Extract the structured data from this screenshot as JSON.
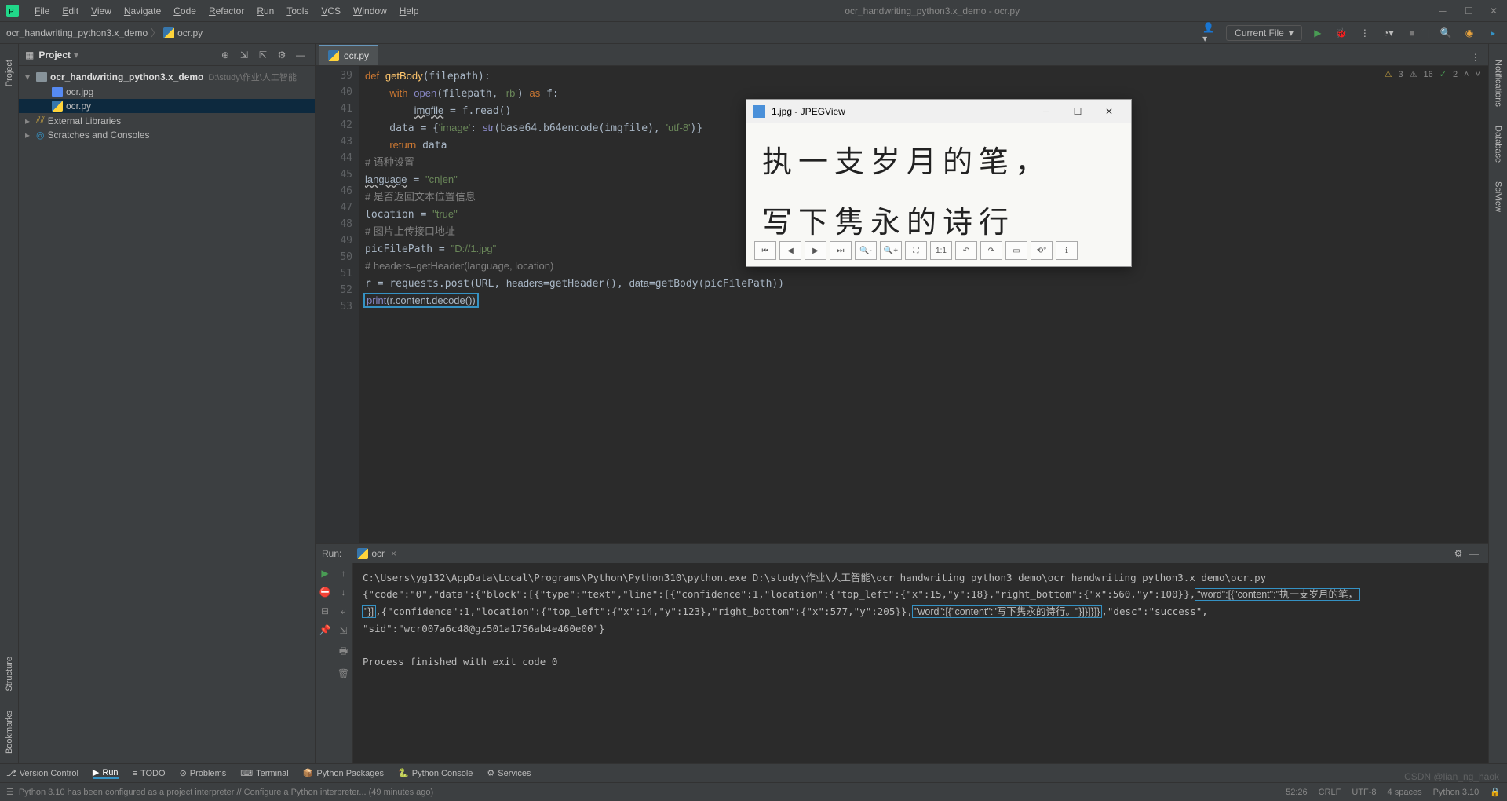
{
  "titlebar": {
    "menus": [
      "File",
      "Edit",
      "View",
      "Navigate",
      "Code",
      "Refactor",
      "Run",
      "Tools",
      "VCS",
      "Window",
      "Help"
    ],
    "center_title": "ocr_handwriting_python3.x_demo - ocr.py"
  },
  "breadcrumb": {
    "project": "ocr_handwriting_python3.x_demo",
    "file": "ocr.py"
  },
  "toolbar": {
    "run_config": "Current File"
  },
  "project_panel": {
    "title": "Project",
    "root": "ocr_handwriting_python3.x_demo",
    "root_path": "D:\\study\\作业\\人工智能",
    "children": [
      "ocr.jpg",
      "ocr.py"
    ],
    "external": "External Libraries",
    "scratches": "Scratches and Consoles"
  },
  "editor": {
    "tab": "ocr.py",
    "line_start": 39,
    "lines": [
      {
        "n": 39,
        "html": "<span class='kw'>def</span> <span class='fn'>getBody</span>(filepath):"
      },
      {
        "n": 40,
        "html": "    <span class='kw'>with</span> <span class='builtin'>open</span>(filepath, <span class='str'>'rb'</span>) <span class='kw'>as</span> f:"
      },
      {
        "n": 41,
        "html": "        <span class='underline'>imgfile</span> = f.read()"
      },
      {
        "n": 42,
        "html": "    data = {<span class='str'>'image'</span>: <span class='builtin'>str</span>(base64.b64encode(imgfile), <span class='str'>'utf-8'</span>)}"
      },
      {
        "n": 43,
        "html": "    <span class='kw'>return</span> data"
      },
      {
        "n": 44,
        "html": "<span class='comm'># 语种设置</span>"
      },
      {
        "n": 45,
        "html": "<span class='underline'>language</span> = <span class='str'>\"cn|en\"</span>"
      },
      {
        "n": 46,
        "html": "<span class='comm'># 是否返回文本位置信息</span>"
      },
      {
        "n": 47,
        "html": "location = <span class='str'>\"true\"</span>"
      },
      {
        "n": 48,
        "html": "<span class='comm'># 图片上传接口地址</span>"
      },
      {
        "n": 49,
        "html": "picFilePath = <span class='str'>\"D://1.jpg\"</span>"
      },
      {
        "n": 50,
        "html": "<span class='comm'># headers=getHeader(language, location)</span>"
      },
      {
        "n": 51,
        "html": "r = requests.post(URL, <span class='param'>headers</span>=getHeader(), <span class='param'>data</span>=getBody(picFilePath))"
      },
      {
        "n": 52,
        "html": "<span class='highlight-box'><span class='builtin'>print</span>(r.content.decode())</span>"
      },
      {
        "n": 53,
        "html": ""
      }
    ],
    "inspections": {
      "warn": "3",
      "weak": "16",
      "ok": "2"
    }
  },
  "run": {
    "label": "Run:",
    "tab": "ocr",
    "lines": [
      "C:\\Users\\yg132\\AppData\\Local\\Programs\\Python\\Python310\\python.exe D:\\study\\作业\\人工智能\\ocr_handwriting_python3_demo\\ocr_handwriting_python3.x_demo\\ocr.py",
      "{\"code\":\"0\",\"data\":{\"block\":[{\"type\":\"text\",\"line\":[{\"confidence\":1,\"location\":{\"top_left\":{\"x\":15,\"y\":18},\"right_bottom\":{\"x\":560,\"y\":100}},<span class='json-box'>\"word\":[{\"content\":\"执一支岁月的笔，</span>",
      "<span class='json-box'>\"}]</span>,{\"confidence\":1,\"location\":{\"top_left\":{\"x\":14,\"y\":123},\"right_bottom\":{\"x\":577,\"y\":205}},<span class='json-box'>\"word\":[{\"content\":\"写下隽永的诗行。\"}]}]}]}</span>,\"desc\":\"success\",",
      "\"sid\":\"wcr007a6c48@gz501a1756ab4e460e00\"}",
      "",
      "Process finished with exit code 0"
    ]
  },
  "bottom_tools": {
    "items": [
      "Version Control",
      "Run",
      "TODO",
      "Problems",
      "Terminal",
      "Python Packages",
      "Python Console",
      "Services"
    ]
  },
  "status": {
    "message": "Python 3.10 has been configured as a project interpreter // Configure a Python interpreter... (49 minutes ago)",
    "cursor": "52:26",
    "crlf": "CRLF",
    "encoding": "UTF-8",
    "indent": "4 spaces",
    "interpreter": "Python 3.10"
  },
  "jpegview": {
    "title": "1.jpg - JPEGView",
    "line1": "执一支岁月的笔，",
    "line2": "写下隽永的诗行"
  },
  "side_tabs": {
    "left": [
      "Project",
      "Bookmarks",
      "Structure"
    ],
    "right": [
      "Notifications",
      "Database",
      "SciView"
    ]
  },
  "watermark": "CSDN @lian_ng_haok"
}
